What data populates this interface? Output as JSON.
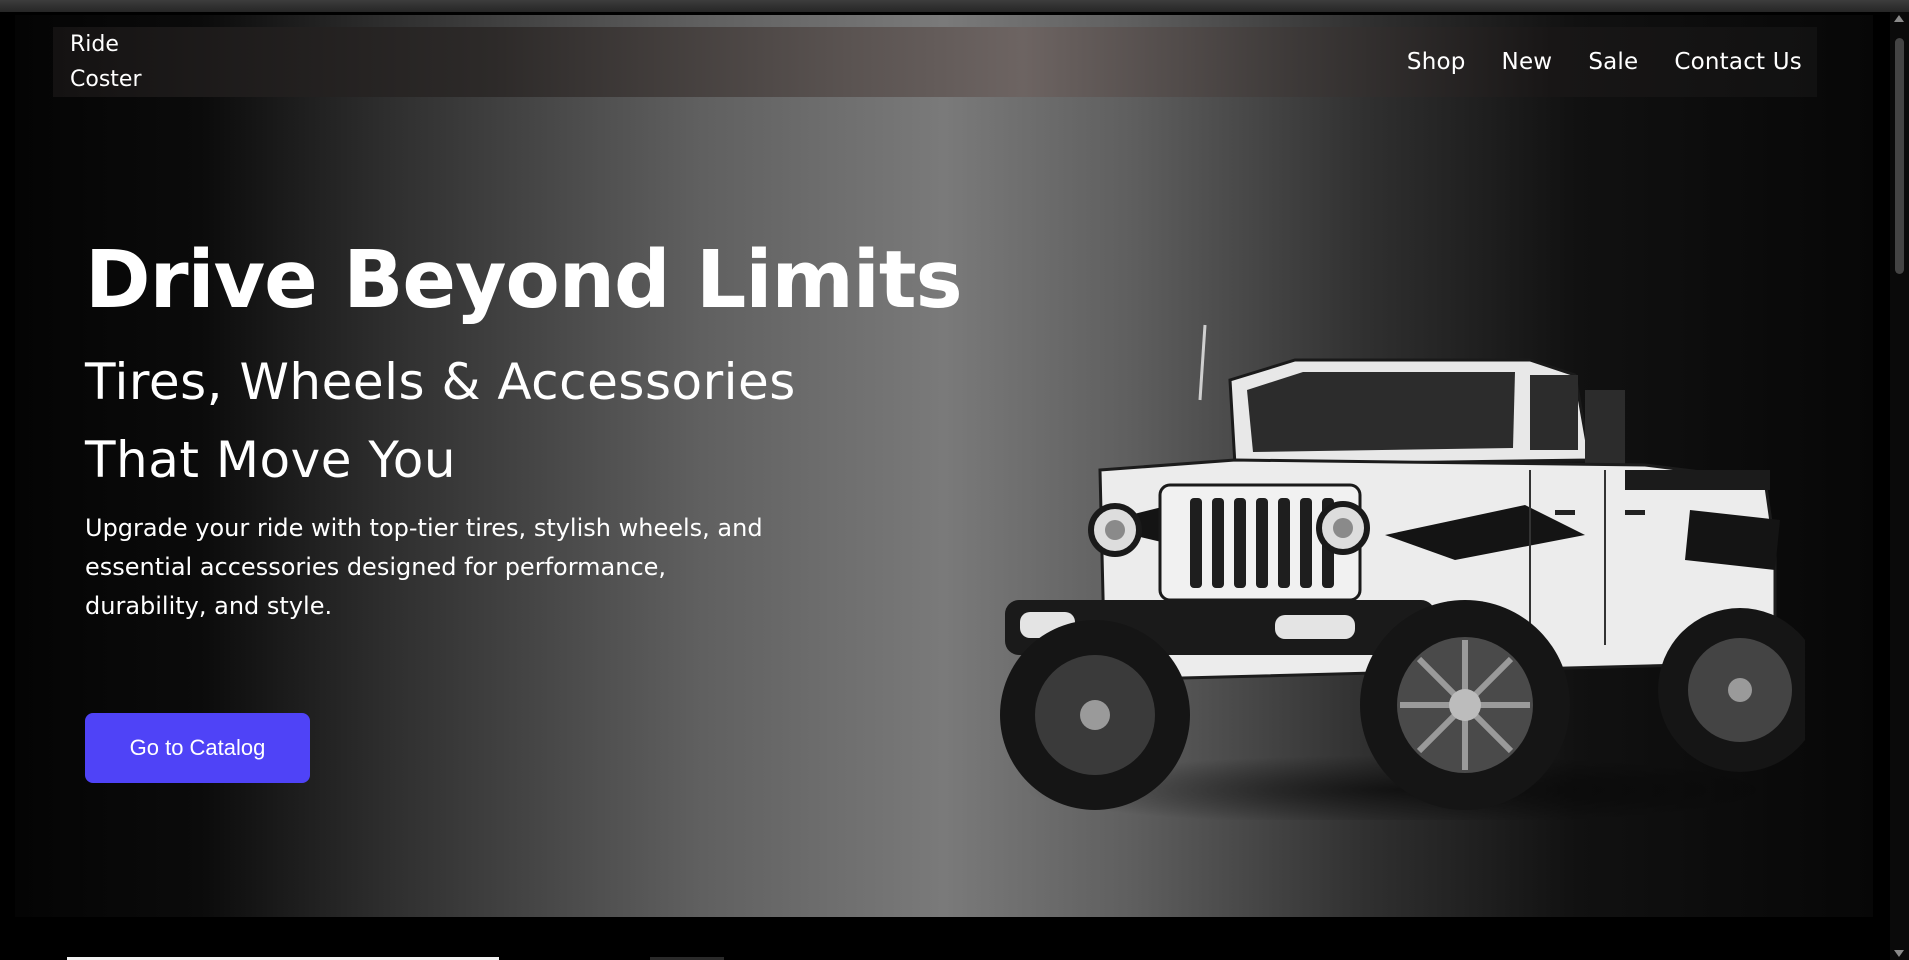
{
  "brand": {
    "name": "Ride Coster"
  },
  "nav": {
    "items": [
      {
        "label": "Shop"
      },
      {
        "label": "New"
      },
      {
        "label": "Sale"
      },
      {
        "label": "Contact Us"
      }
    ]
  },
  "hero": {
    "headline": "Drive Beyond Limits",
    "subheadline": "Tires, Wheels & Accessories That Move You",
    "description": "Upgrade your ride with top-tier tires, stylish wheels, and essential accessories designed for performance, durability, and style.",
    "cta_label": "Go to Catalog"
  },
  "colors": {
    "accent": "#4f43f7",
    "background": "#000000"
  },
  "icons": {
    "hero_image": "white-pickup-truck-image"
  }
}
